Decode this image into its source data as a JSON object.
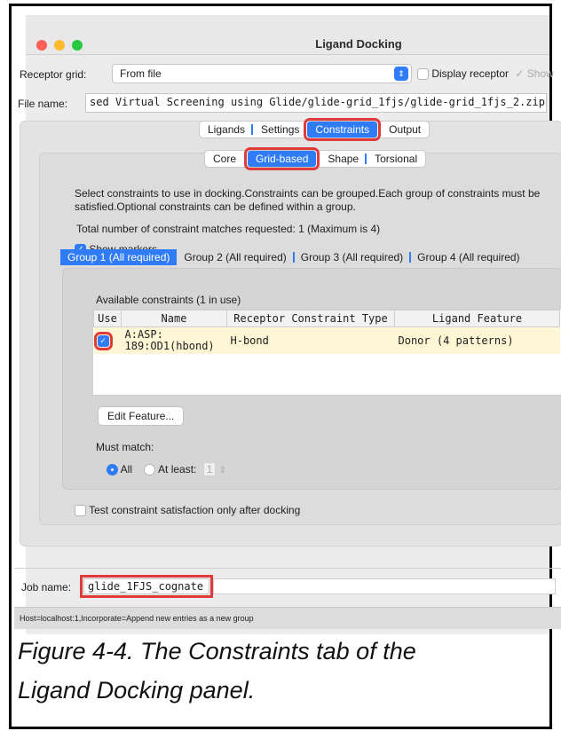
{
  "window": {
    "title": "Ligand Docking"
  },
  "receptor": {
    "label": "Receptor grid:",
    "value": "From file",
    "display_label": "Display receptor",
    "show_label": "Show"
  },
  "file": {
    "label": "File name:",
    "value": "sed Virtual Screening using Glide/glide-grid_1fjs/glide-grid_1fjs_2.zip"
  },
  "main_tabs": [
    "Ligands",
    "Settings",
    "Constraints",
    "Output"
  ],
  "sub_tabs": [
    "Core",
    "Grid-based",
    "Shape",
    "Torsional"
  ],
  "description": {
    "line1": "Select constraints to use in docking.Constraints can be grouped.Each group of constraints must be",
    "line2": "satisfied.Optional constraints can be defined within a group.",
    "total": "Total number of constraint matches requested: 1 (Maximum is 4)"
  },
  "show_markers": "Show markers",
  "group_tabs": [
    "Group 1 (All required)",
    "Group 2 (All required)",
    "Group 3 (All required)",
    "Group 4 (All required)"
  ],
  "available": "Available constraints (1 in use)",
  "table": {
    "headers": [
      "Use",
      "Name",
      "Receptor Constraint Type",
      "Ligand Feature"
    ],
    "row": {
      "name_line1": "A:ASP:",
      "name_line2": "189:OD1(hbond)",
      "type": "H-bond",
      "feature": "Donor (4 patterns)"
    }
  },
  "edit_feature": "Edit Feature...",
  "must_match": {
    "label": "Must match:",
    "all": "All",
    "at_least": "At least:",
    "at_least_value": "1"
  },
  "test_constraint": "Test constraint satisfaction only after docking",
  "job": {
    "label": "Job name:",
    "value": "glide_1FJS_cognate"
  },
  "status": "Host=localhost:1,Incorporate=Append new entries as a new group",
  "caption": {
    "line1": "Figure 4-4. The Constraints tab of the",
    "line2": "Ligand Docking panel."
  },
  "colors": {
    "accent": "#2f7cf6",
    "highlight": "#e03a3a",
    "selected_row": "#fff6d5"
  }
}
